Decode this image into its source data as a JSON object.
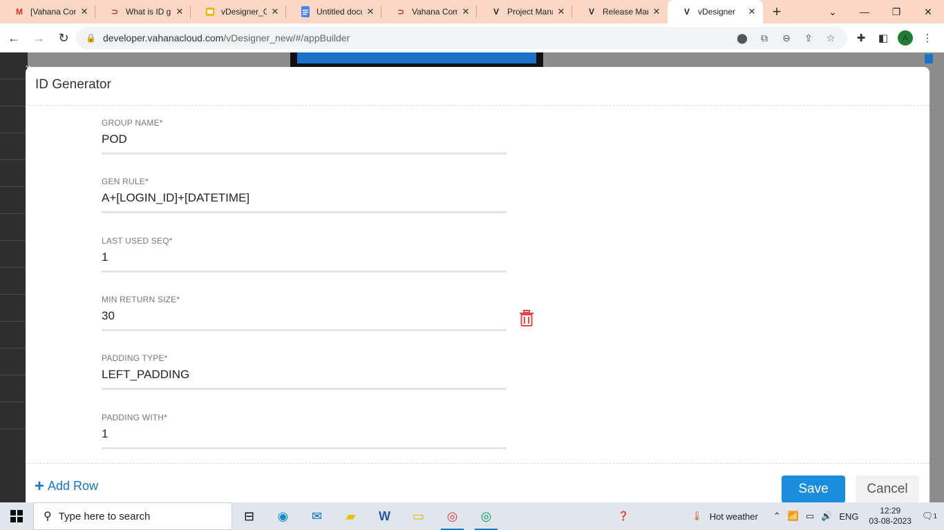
{
  "browser": {
    "tabs": [
      {
        "title": "[Vahana Com",
        "icon": "gmail-icon",
        "color": "#d93025"
      },
      {
        "title": "What is ID ge",
        "icon": "vahana-icon",
        "color": "#b3261e"
      },
      {
        "title": "vDesigner_Ge",
        "icon": "slides-icon",
        "color": "#f4b400"
      },
      {
        "title": "Untitled docu",
        "icon": "docs-icon",
        "color": "#4285f4"
      },
      {
        "title": "Vahana Comm",
        "icon": "vahana-icon",
        "color": "#b3261e"
      },
      {
        "title": "Project Mana",
        "icon": "v-icon",
        "color": "#333333"
      },
      {
        "title": "Release Mana",
        "icon": "v-icon",
        "color": "#333333"
      },
      {
        "title": "vDesigner",
        "icon": "v-icon",
        "color": "#333333",
        "active": true
      }
    ],
    "url_host": "developer.vahanacloud.com",
    "url_path": "/vDesigner_new/#/appBuilder",
    "profile_initial": "A"
  },
  "modal": {
    "title": "ID Generator",
    "fields": [
      {
        "label": "GROUP NAME*",
        "value": "POD"
      },
      {
        "label": "GEN RULE*",
        "value": "A+[LOGIN_ID]+[DATETIME]"
      },
      {
        "label": "LAST USED SEQ*",
        "value": "1"
      },
      {
        "label": "MIN RETURN SIZE*",
        "value": "30"
      },
      {
        "label": "PADDING TYPE*",
        "value": "LEFT_PADDING"
      },
      {
        "label": "PADDING WITH*",
        "value": "1"
      }
    ],
    "add_row_label": "Add Row",
    "save_label": "Save",
    "cancel_label": "Cancel",
    "accent_color": "#1a8ddf",
    "delete_color": "#e04848"
  },
  "taskbar": {
    "search_placeholder": "Type here to search",
    "weather": "Hot weather",
    "language": "ENG",
    "time": "12:29",
    "date": "03-08-2023",
    "notification_count": "1"
  }
}
